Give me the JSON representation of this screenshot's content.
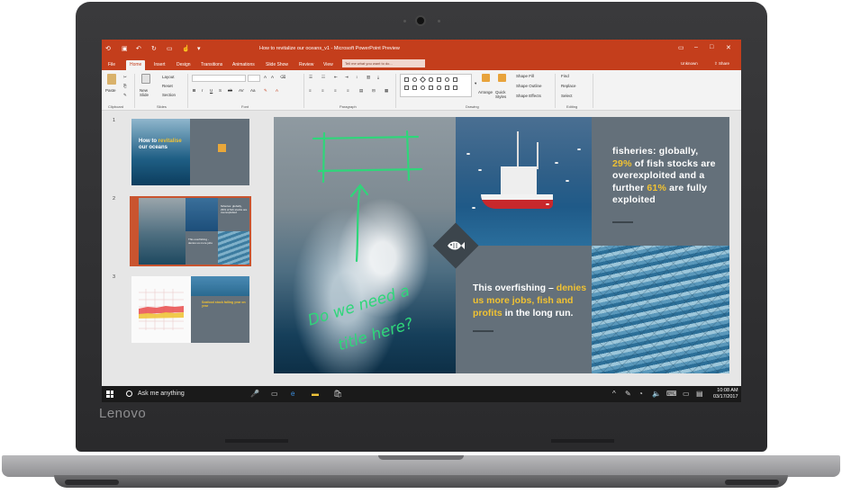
{
  "device": {
    "brand": "Lenovo"
  },
  "window": {
    "title": "How to revitalize our oceans_v1 - Microsoft PowerPoint Preview",
    "user": "Unknown",
    "share_label": "Share"
  },
  "tabs": [
    {
      "label": "File"
    },
    {
      "label": "Home"
    },
    {
      "label": "Insert"
    },
    {
      "label": "Design"
    },
    {
      "label": "Transitions"
    },
    {
      "label": "Animations"
    },
    {
      "label": "Slide Show"
    },
    {
      "label": "Review"
    },
    {
      "label": "View"
    }
  ],
  "tell_me_placeholder": "Tell me what you want to do...",
  "ribbon": {
    "paste": "Paste",
    "new_slide": "New Slide",
    "layout": "Layout",
    "reset": "Reset",
    "section": "Section",
    "arrange": "Arrange",
    "quick_styles": "Quick Styles",
    "shape_fill": "Shape Fill",
    "shape_outline": "Shape Outline",
    "shape_effects": "Shape Effects",
    "find": "Find",
    "replace": "Replace",
    "select": "Select",
    "groups": {
      "clipboard": "Clipboard",
      "slides": "Slides",
      "font": "Font",
      "paragraph": "Paragraph",
      "drawing": "Drawing",
      "editing": "Editing"
    }
  },
  "thumbnails": [
    {
      "number": "1",
      "title_line1": "How to",
      "title_hl": "revitalise",
      "title_line2": "our oceans"
    },
    {
      "number": "2",
      "text_a": "fisheries: globally, 29% of fish stocks are overexploited",
      "text_b": "This overfishing - denies us more jobs"
    },
    {
      "number": "3",
      "text": "Seafood stock falling year on year"
    }
  ],
  "slide": {
    "stat_pre": "fisheries: globally,",
    "stat_hl1": "29%",
    "stat_mid": "of fish stocks are overexploited and a further",
    "stat_hl2": "61%",
    "stat_post": "are fully exploited",
    "over_pre": "This overfishing –",
    "over_hl": "denies us more jobs, fish and profits",
    "over_post": "in the long run.",
    "ink_line1": "Do we need a",
    "ink_line2": "title here?"
  },
  "taskbar": {
    "search_label": "Ask me anything",
    "time": "10:08 AM",
    "date": "03/17/2017"
  }
}
